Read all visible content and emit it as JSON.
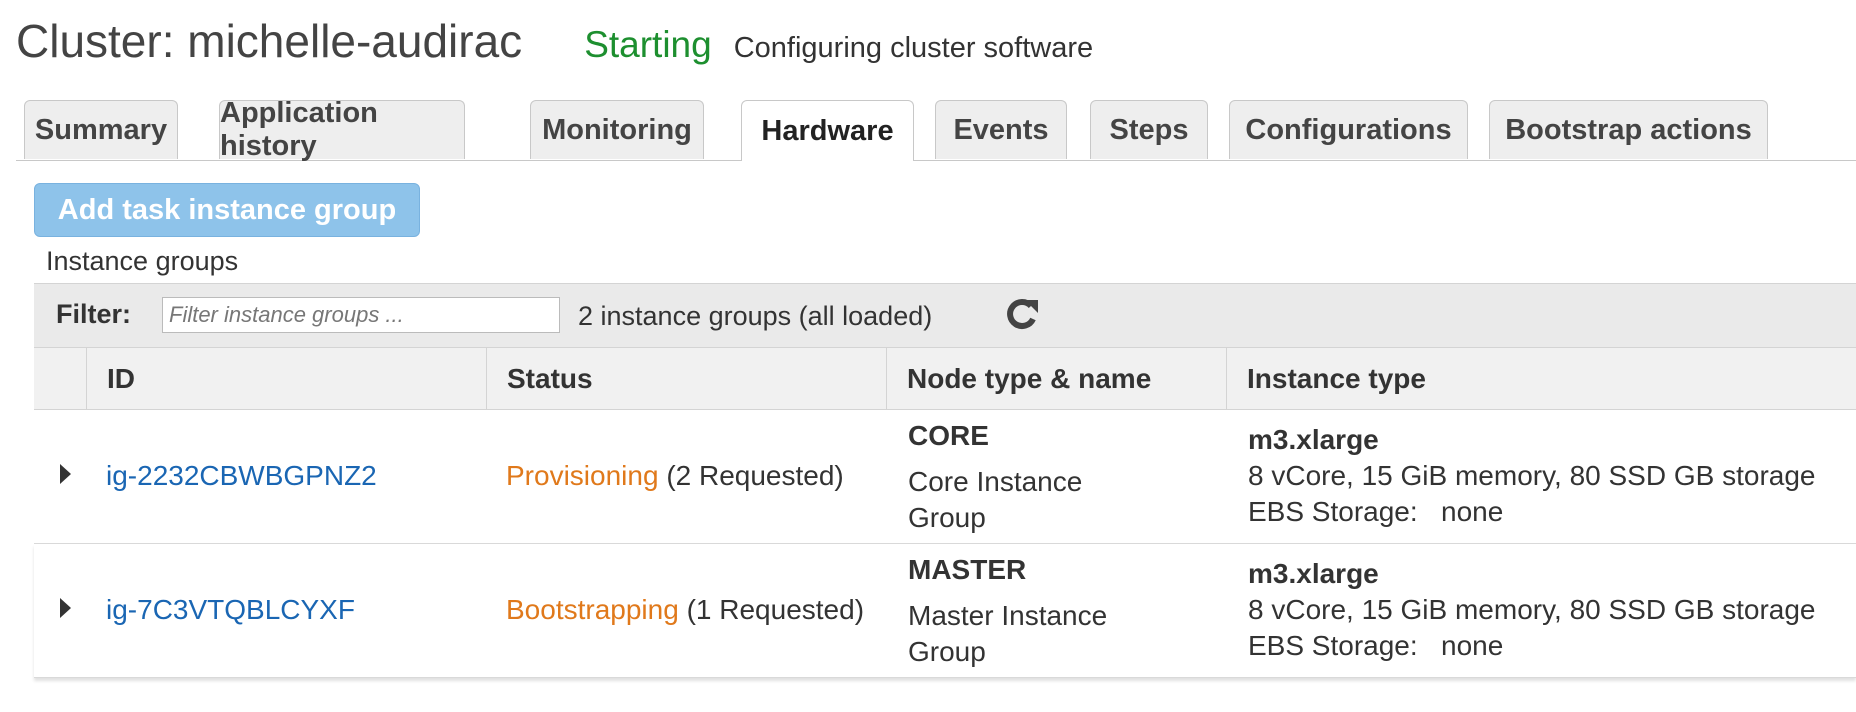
{
  "header": {
    "cluster_title": "Cluster: michelle-audirac",
    "status": "Starting",
    "status_detail": "Configuring cluster software",
    "status_color": "#1d8f2f"
  },
  "tabs": [
    {
      "label": "Summary",
      "active": false
    },
    {
      "label": "Application history",
      "active": false
    },
    {
      "label": "Monitoring",
      "active": false
    },
    {
      "label": "Hardware",
      "active": true
    },
    {
      "label": "Events",
      "active": false
    },
    {
      "label": "Steps",
      "active": false
    },
    {
      "label": "Configurations",
      "active": false
    },
    {
      "label": "Bootstrap actions",
      "active": false
    }
  ],
  "add_button": {
    "label": "Add task instance group"
  },
  "section": {
    "label": "Instance groups"
  },
  "filter": {
    "label": "Filter:",
    "placeholder": "Filter instance groups ...",
    "count_text": "2 instance groups (all loaded)",
    "refresh_icon": "refresh-icon"
  },
  "table": {
    "columns": [
      "ID",
      "Status",
      "Node type & name",
      "Instance type"
    ],
    "rows": [
      {
        "id": "ig-2232CBWBGPNZ2",
        "status": "Provisioning",
        "status_detail": "(2 Requested)",
        "node_type": "CORE",
        "node_name": "Core Instance Group",
        "instance_type": "m3.xlarge",
        "instance_spec": "8 vCore, 15 GiB memory, 80 SSD GB storage",
        "ebs": "EBS Storage:   none"
      },
      {
        "id": "ig-7C3VTQBLCYXF",
        "status": "Bootstrapping",
        "status_detail": "(1 Requested)",
        "node_type": "MASTER",
        "node_name": "Master Instance Group",
        "instance_type": "m3.xlarge",
        "instance_spec": "8 vCore, 15 GiB memory, 80 SSD GB storage",
        "ebs": "EBS Storage:   none"
      }
    ]
  },
  "colors": {
    "link": "#1a66b3",
    "warning": "#e0791b",
    "button": "#8ec3ea"
  }
}
